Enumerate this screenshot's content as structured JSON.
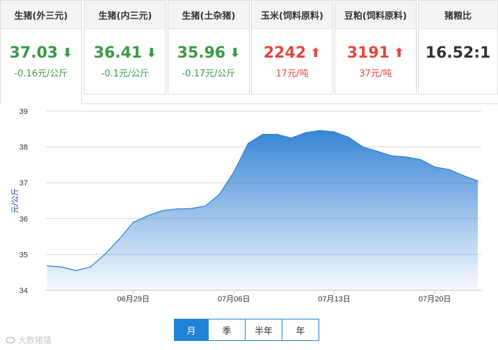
{
  "cards": [
    {
      "title": "生猪(外三元)",
      "value": "37.03",
      "direction": "down",
      "arrow": "⬇",
      "change": "-0.16元/公斤"
    },
    {
      "title": "生猪(内三元)",
      "value": "36.41",
      "direction": "down",
      "arrow": "⬇",
      "change": "-0.1元/公斤"
    },
    {
      "title": "生猪(土杂猪)",
      "value": "35.96",
      "direction": "down",
      "arrow": "⬇",
      "change": "-0.17元/公斤"
    },
    {
      "title": "玉米(饲料原料)",
      "value": "2242",
      "direction": "up",
      "arrow": "⬆",
      "change": "17元/吨"
    },
    {
      "title": "豆粕(饲料原料)",
      "value": "3191",
      "direction": "up",
      "arrow": "⬆",
      "change": "37元/吨"
    },
    {
      "title": "猪粮比",
      "value": "16.52:1",
      "direction": "neutral",
      "arrow": "",
      "change": ""
    }
  ],
  "colors": {
    "down": "#3a9a48",
    "up": "#e5463f",
    "accent": "#1f83d8",
    "line": "#2d7fd4"
  },
  "range_tabs": [
    "月",
    "季",
    "半年",
    "年"
  ],
  "selected_range": "月",
  "watermark": "大数猪猿",
  "chart_data": {
    "type": "area",
    "ylabel": "元/公斤",
    "ylim": [
      34,
      39
    ],
    "yticks": [
      34,
      35,
      36,
      37,
      38,
      39
    ],
    "xticks": [
      {
        "day": 6,
        "label": "06月29日"
      },
      {
        "day": 13,
        "label": "07月06日"
      },
      {
        "day": 20,
        "label": "07月13日"
      },
      {
        "day": 27,
        "label": "07月20日"
      }
    ],
    "grid": true,
    "series": [
      {
        "days": [
          0,
          1,
          2,
          3,
          4,
          5,
          6,
          7,
          8,
          9,
          10,
          11,
          12,
          13,
          14,
          15,
          16,
          17,
          18,
          19,
          20,
          21,
          22,
          23,
          24,
          25,
          26,
          27,
          28,
          29,
          30
        ],
        "values": [
          34.68,
          34.65,
          34.55,
          34.65,
          35.0,
          35.42,
          35.9,
          36.08,
          36.22,
          36.27,
          36.28,
          36.35,
          36.68,
          37.3,
          38.1,
          38.35,
          38.35,
          38.25,
          38.4,
          38.46,
          38.42,
          38.27,
          38.0,
          37.88,
          37.75,
          37.72,
          37.65,
          37.44,
          37.37,
          37.2,
          37.05
        ]
      }
    ]
  }
}
